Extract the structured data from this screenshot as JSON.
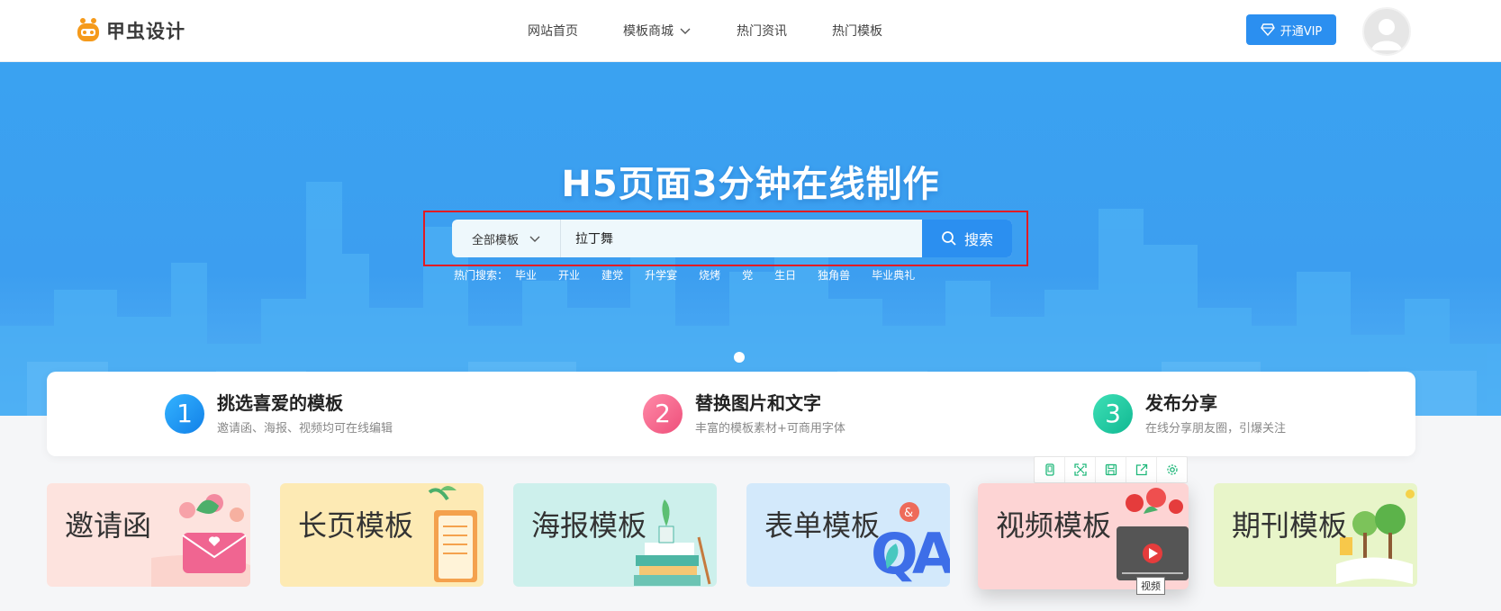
{
  "header": {
    "logo_text": "甲虫设计",
    "nav": [
      {
        "label": "网站首页"
      },
      {
        "label": "模板商城",
        "has_dropdown": true
      },
      {
        "label": "热门资讯"
      },
      {
        "label": "热门模板"
      }
    ],
    "vip_label": "开通VIP",
    "colors": {
      "accent": "#2b8ff0"
    }
  },
  "banner": {
    "title": "H5页面3分钟在线制作",
    "search": {
      "category_selected": "全部模板",
      "query": "拉丁舞",
      "button_label": "搜索"
    },
    "hot_label": "热门搜索：",
    "hot_tags": [
      "毕业",
      "开业",
      "建党",
      "升学宴",
      "烧烤",
      "党",
      "生日",
      "独角兽",
      "毕业典礼"
    ]
  },
  "steps": [
    {
      "number": "1",
      "title": "挑选喜爱的模板",
      "desc": "邀请函、海报、视频均可在线编辑",
      "color": "#1f9af2"
    },
    {
      "number": "2",
      "title": "替换图片和文字",
      "desc": "丰富的模板素材+可商用字体",
      "color": "#f4638a"
    },
    {
      "number": "3",
      "title": "发布分享",
      "desc": "在线分享朋友圈，引爆关注",
      "color": "#18c9a2"
    }
  ],
  "toolbar": {
    "icons": [
      "mobile-icon",
      "expand-icon",
      "save-icon",
      "share-icon",
      "settings-icon"
    ],
    "color": "#1fb87a"
  },
  "categories": [
    {
      "label": "邀请函",
      "bg": "#fde3de"
    },
    {
      "label": "长页模板",
      "bg": "#fdeab4"
    },
    {
      "label": "海报模板",
      "bg": "#cdf0ec"
    },
    {
      "label": "表单模板",
      "bg": "#d3e9fb"
    },
    {
      "label": "视频模板",
      "bg": "#fdd4d4"
    },
    {
      "label": "期刊模板",
      "bg": "#e8f5c9"
    }
  ],
  "tooltip": "视频"
}
